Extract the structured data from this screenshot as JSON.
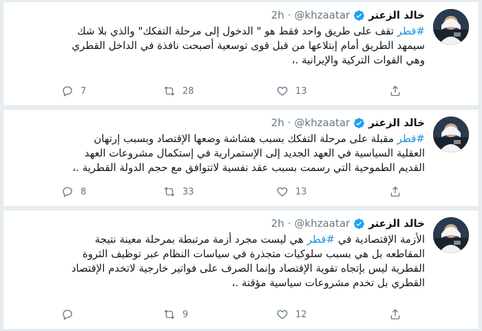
{
  "tweets": [
    {
      "name": "خالد الزعتر",
      "handle": "@khzaatar",
      "dot": "·",
      "time": "2h",
      "lines": [
        {
          "hashtag": "#قطر",
          "text": " تقف على طريق واحد فقط هو \" الدخول إلى مرحلة التفكك\" والذي بلا شك"
        },
        {
          "hashtag": "",
          "text": "سيمهد الطريق أمام إبتلاعها من قبل قوى توسعية أصبحت نافذة في الداخل القطري"
        },
        {
          "hashtag": "",
          "text": "وهي القوات التركية والإيرانية .،"
        }
      ],
      "replies": "7",
      "retweets": "28",
      "likes": "13"
    },
    {
      "name": "خالد الزعتر",
      "handle": "@khzaatar",
      "dot": "·",
      "time": "2h",
      "lines": [
        {
          "hashtag": "#قطر",
          "text": " مقبلة على مرحلة التفكك بسبب هشاشة وضعها الإقتصاد وبسبب إرتهان"
        },
        {
          "hashtag": "",
          "text": "العقلية السياسية في العهد الجديد إلى الإستمرارية في إستكمال مشروعات العهد"
        },
        {
          "hashtag": "",
          "text": "القديم الطموحية التي رسمت بسبب عقد نفسية لاتتوافق مع حجم الدولة القطرية .،"
        }
      ],
      "replies": "8",
      "retweets": "33",
      "likes": "13"
    },
    {
      "name": "خالد الزعتر",
      "handle": "@khzaatar",
      "dot": "·",
      "time": "2h",
      "lines": [
        {
          "hashtag": "",
          "text": "الأزمة الإقتصادية في ",
          "hashtag_mid": "#قطر",
          "text_after": " هي ليست مجرد أزمة مرتبطة بمرحلة معينة نتيجة"
        },
        {
          "hashtag": "",
          "text": "المقاطعه بل هي بسبب سلوكيات متجذرة في سياسات النظام عبر توظيف الثروة"
        },
        {
          "hashtag": "",
          "text": "القطرية ليس بإتجاه تقوية الإقتصاد وإنما الصرف على فواتير خارجية لاتخدم الإقتصاد"
        },
        {
          "hashtag": "",
          "text": "القطري بل تخدم مشروعات سياسية مؤقتة .،"
        }
      ],
      "replies": "",
      "retweets": "9",
      "likes": "12"
    }
  ],
  "icons": {
    "reply": "reply-icon",
    "retweet": "retweet-icon",
    "like": "heart-icon",
    "share": "share-icon",
    "verified": "verified-badge-icon"
  },
  "colors": {
    "hashtag": "#1b95e0",
    "verified": "#1da1f2",
    "muted": "#657786",
    "text": "#14171a"
  }
}
